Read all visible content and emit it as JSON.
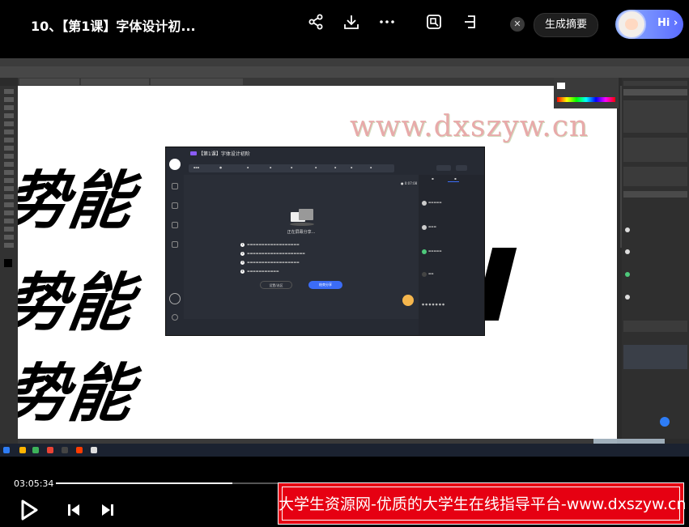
{
  "header": {
    "title": "10、【第1课】字体设计初...",
    "summary_label": "生成摘要",
    "hi_label": "Hi ›",
    "close_glyph": "✕"
  },
  "icons": {
    "share": "share-icon",
    "download": "download-icon",
    "more": "more-icon",
    "screenshot": "screenshot-icon",
    "pip": "pip-icon"
  },
  "video": {
    "watermark": "www.dxszyw.cn",
    "big_chars": [
      "势能",
      "势能",
      "势能"
    ],
    "inner_window": {
      "title": "【第1课】字体设计初阶",
      "timer": "● 0:07:08",
      "sharing_text": "正在屏幕分享...",
      "tips": [
        "1",
        "2",
        "3",
        "4"
      ],
      "settings_label": "设置/选区",
      "end_label": "结束分享"
    }
  },
  "controls": {
    "current_time": "03:05:34",
    "progress": 0.32
  },
  "banner": {
    "text": "大学生资源网-优质的大学生在线指导平台-www.dxszyw.cn"
  },
  "colors": {
    "banner_bg": "#e60012",
    "accent_blue": "#3b6cf6",
    "hi_gradient_end": "#5b6cff"
  }
}
